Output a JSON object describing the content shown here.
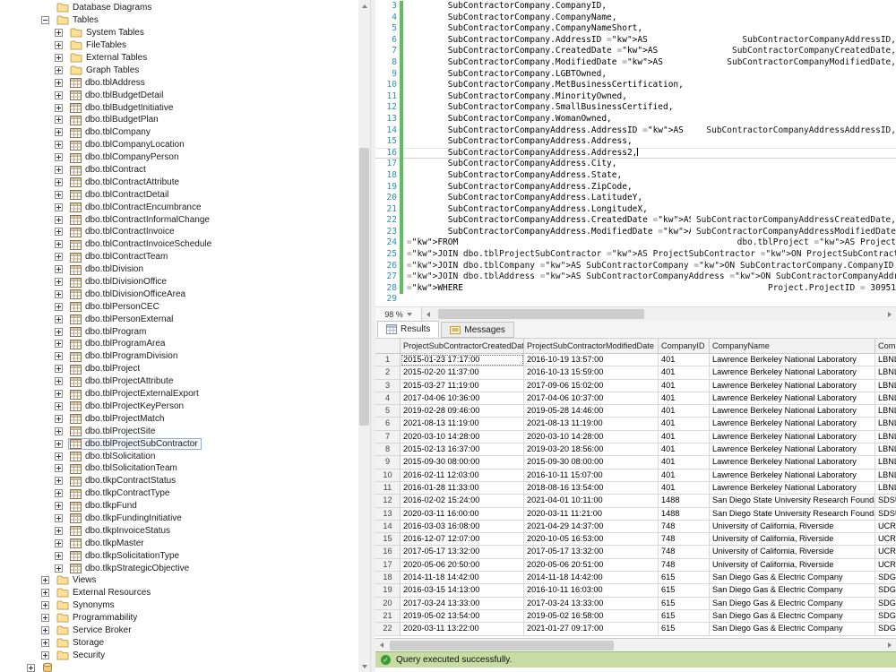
{
  "object_explorer": {
    "items": [
      {
        "label": "Database Diagrams",
        "indent": 1,
        "expander": "none",
        "icon": "folder"
      },
      {
        "label": "Tables",
        "indent": 1,
        "expander": "minus",
        "icon": "folder"
      },
      {
        "label": "System Tables",
        "indent": 2,
        "expander": "plus",
        "icon": "folder"
      },
      {
        "label": "FileTables",
        "indent": 2,
        "expander": "plus",
        "icon": "folder"
      },
      {
        "label": "External Tables",
        "indent": 2,
        "expander": "plus",
        "icon": "folder"
      },
      {
        "label": "Graph Tables",
        "indent": 2,
        "expander": "plus",
        "icon": "folder"
      },
      {
        "label": "dbo.tblAddress",
        "indent": 2,
        "expander": "plus",
        "icon": "table"
      },
      {
        "label": "dbo.tblBudgetDetail",
        "indent": 2,
        "expander": "plus",
        "icon": "table"
      },
      {
        "label": "dbo.tblBudgetInitiative",
        "indent": 2,
        "expander": "plus",
        "icon": "table"
      },
      {
        "label": "dbo.tblBudgetPlan",
        "indent": 2,
        "expander": "plus",
        "icon": "table"
      },
      {
        "label": "dbo.tblCompany",
        "indent": 2,
        "expander": "plus",
        "icon": "table"
      },
      {
        "label": "dbo.tblCompanyLocation",
        "indent": 2,
        "expander": "plus",
        "icon": "table"
      },
      {
        "label": "dbo.tblCompanyPerson",
        "indent": 2,
        "expander": "plus",
        "icon": "table"
      },
      {
        "label": "dbo.tblContract",
        "indent": 2,
        "expander": "plus",
        "icon": "table"
      },
      {
        "label": "dbo.tblContractAttribute",
        "indent": 2,
        "expander": "plus",
        "icon": "table"
      },
      {
        "label": "dbo.tblContractDetail",
        "indent": 2,
        "expander": "plus",
        "icon": "table"
      },
      {
        "label": "dbo.tblContractEncumbrance",
        "indent": 2,
        "expander": "plus",
        "icon": "table"
      },
      {
        "label": "dbo.tblContractInformalChange",
        "indent": 2,
        "expander": "plus",
        "icon": "table"
      },
      {
        "label": "dbo.tblContractInvoice",
        "indent": 2,
        "expander": "plus",
        "icon": "table"
      },
      {
        "label": "dbo.tblContractInvoiceSchedule",
        "indent": 2,
        "expander": "plus",
        "icon": "table"
      },
      {
        "label": "dbo.tblContractTeam",
        "indent": 2,
        "expander": "plus",
        "icon": "table"
      },
      {
        "label": "dbo.tblDivision",
        "indent": 2,
        "expander": "plus",
        "icon": "table"
      },
      {
        "label": "dbo.tblDivisionOffice",
        "indent": 2,
        "expander": "plus",
        "icon": "table"
      },
      {
        "label": "dbo.tblDivisionOfficeArea",
        "indent": 2,
        "expander": "plus",
        "icon": "table"
      },
      {
        "label": "dbo.tblPersonCEC",
        "indent": 2,
        "expander": "plus",
        "icon": "table"
      },
      {
        "label": "dbo.tblPersonExternal",
        "indent": 2,
        "expander": "plus",
        "icon": "table"
      },
      {
        "label": "dbo.tblProgram",
        "indent": 2,
        "expander": "plus",
        "icon": "table"
      },
      {
        "label": "dbo.tblProgramArea",
        "indent": 2,
        "expander": "plus",
        "icon": "table"
      },
      {
        "label": "dbo.tblProgramDivision",
        "indent": 2,
        "expander": "plus",
        "icon": "table"
      },
      {
        "label": "dbo.tblProject",
        "indent": 2,
        "expander": "plus",
        "icon": "table"
      },
      {
        "label": "dbo.tblProjectAttribute",
        "indent": 2,
        "expander": "plus",
        "icon": "table"
      },
      {
        "label": "dbo.tblProjectExternalExport",
        "indent": 2,
        "expander": "plus",
        "icon": "table"
      },
      {
        "label": "dbo.tblProjectKeyPerson",
        "indent": 2,
        "expander": "plus",
        "icon": "table"
      },
      {
        "label": "dbo.tblProjectMatch",
        "indent": 2,
        "expander": "plus",
        "icon": "table"
      },
      {
        "label": "dbo.tblProjectSite",
        "indent": 2,
        "expander": "plus",
        "icon": "table"
      },
      {
        "label": "dbo.tblProjectSubContractor",
        "indent": 2,
        "expander": "plus",
        "icon": "table",
        "selected": true
      },
      {
        "label": "dbo.tblSolicitation",
        "indent": 2,
        "expander": "plus",
        "icon": "table"
      },
      {
        "label": "dbo.tblSolicitationTeam",
        "indent": 2,
        "expander": "plus",
        "icon": "table"
      },
      {
        "label": "dbo.tlkpContractStatus",
        "indent": 2,
        "expander": "plus",
        "icon": "table"
      },
      {
        "label": "dbo.tlkpContractType",
        "indent": 2,
        "expander": "plus",
        "icon": "table"
      },
      {
        "label": "dbo.tlkpFund",
        "indent": 2,
        "expander": "plus",
        "icon": "table"
      },
      {
        "label": "dbo.tlkpFundingInitiative",
        "indent": 2,
        "expander": "plus",
        "icon": "table"
      },
      {
        "label": "dbo.tlkpInvoiceStatus",
        "indent": 2,
        "expander": "plus",
        "icon": "table"
      },
      {
        "label": "dbo.tlkpMaster",
        "indent": 2,
        "expander": "plus",
        "icon": "table"
      },
      {
        "label": "dbo.tlkpSolicitationType",
        "indent": 2,
        "expander": "plus",
        "icon": "table"
      },
      {
        "label": "dbo.tlkpStrategicObjective",
        "indent": 2,
        "expander": "plus",
        "icon": "table"
      },
      {
        "label": "Views",
        "indent": 1,
        "expander": "plus",
        "icon": "folder"
      },
      {
        "label": "External Resources",
        "indent": 1,
        "expander": "plus",
        "icon": "folder"
      },
      {
        "label": "Synonyms",
        "indent": 1,
        "expander": "plus",
        "icon": "folder"
      },
      {
        "label": "Programmability",
        "indent": 1,
        "expander": "plus",
        "icon": "folder"
      },
      {
        "label": "Service Broker",
        "indent": 1,
        "expander": "plus",
        "icon": "folder"
      },
      {
        "label": "Storage",
        "indent": 1,
        "expander": "plus",
        "icon": "folder"
      },
      {
        "label": "Security",
        "indent": 1,
        "expander": "plus",
        "icon": "folder"
      },
      {
        "label": "",
        "indent": 0,
        "expander": "plus",
        "icon": "database"
      }
    ]
  },
  "editor": {
    "zoom_label": "98 %",
    "cursor_line": 16,
    "lines": [
      {
        "num": 3,
        "changed": true,
        "text": "        SubContractorCompany.CompanyID,"
      },
      {
        "num": 4,
        "changed": true,
        "text": "        SubContractorCompany.CompanyName,"
      },
      {
        "num": 5,
        "changed": true,
        "text": "        SubContractorCompany.CompanyNameShort,"
      },
      {
        "num": 6,
        "changed": true,
        "text": "        SubContractorCompany.AddressID AS SubContractorCompanyAddressID,"
      },
      {
        "num": 7,
        "changed": true,
        "text": "        SubContractorCompany.CreatedDate AS SubContractorCompanyCreatedDate,"
      },
      {
        "num": 8,
        "changed": true,
        "text": "        SubContractorCompany.ModifiedDate AS SubContractorCompanyModifiedDate,"
      },
      {
        "num": 9,
        "changed": true,
        "text": "        SubContractorCompany.LGBTOwned,"
      },
      {
        "num": 10,
        "changed": true,
        "text": "        SubContractorCompany.MetBusinessCertification,"
      },
      {
        "num": 11,
        "changed": true,
        "text": "        SubContractorCompany.MinorityOwned,"
      },
      {
        "num": 12,
        "changed": true,
        "text": "        SubContractorCompany.SmallBusinessCertified,"
      },
      {
        "num": 13,
        "changed": true,
        "text": "        SubContractorCompany.WomanOwned,"
      },
      {
        "num": 14,
        "changed": true,
        "text": "        SubContractorCompanyAddress.AddressID AS SubContractorCompanyAddressAddressID,"
      },
      {
        "num": 15,
        "changed": true,
        "text": "        SubContractorCompanyAddress.Address,"
      },
      {
        "num": 16,
        "changed": true,
        "text": "        SubContractorCompanyAddress.Address2,"
      },
      {
        "num": 17,
        "changed": true,
        "text": "        SubContractorCompanyAddress.City,"
      },
      {
        "num": 18,
        "changed": true,
        "text": "        SubContractorCompanyAddress.State,"
      },
      {
        "num": 19,
        "changed": true,
        "text": "        SubContractorCompanyAddress.ZipCode,"
      },
      {
        "num": 20,
        "changed": true,
        "text": "        SubContractorCompanyAddress.LatitudeY,"
      },
      {
        "num": 21,
        "changed": true,
        "text": "        SubContractorCompanyAddress.LongitudeX,"
      },
      {
        "num": 22,
        "changed": true,
        "text": "        SubContractorCompanyAddress.CreatedDate AS SubContractorCompanyAddressCreatedDate,"
      },
      {
        "num": 23,
        "changed": true,
        "text": "        SubContractorCompanyAddress.ModifiedDate AS SubContractorCompanyAddressModifiedDate"
      },
      {
        "num": 24,
        "changed": true,
        "text": "FROM dbo.tblProject AS Project"
      },
      {
        "num": 25,
        "changed": true,
        "text": "INNER JOIN dbo.tblProjectSubContractor AS ProjectSubContractor ON ProjectSubContractor.ProjectNu"
      },
      {
        "num": 26,
        "changed": true,
        "text": "INNER JOIN dbo.tblCompany AS SubContractorCompany ON SubContractorCompany.CompanyID = ProjectSub"
      },
      {
        "num": 27,
        "changed": true,
        "text": "INNER JOIN dbo.tblAddress AS SubContractorCompanyAddress ON SubContractorCompanyAddress.AddressI"
      },
      {
        "num": 28,
        "changed": true,
        "text": "WHERE Project.ProjectID = 30951"
      },
      {
        "num": 29,
        "changed": false,
        "text": ""
      }
    ]
  },
  "results_pane": {
    "tabs": [
      {
        "label": "Results",
        "icon": "grid",
        "active": true
      },
      {
        "label": "Messages",
        "icon": "messages",
        "active": false
      }
    ],
    "grid": {
      "columns": [
        "ProjectSubContractorCreatedDate",
        "ProjectSubContractorModifiedDate",
        "CompanyID",
        "CompanyName",
        "Compa"
      ],
      "selected_cell": {
        "row": 1,
        "col": 1
      },
      "rows": [
        [
          "2015-01-23 17:17:00",
          "2016-10-19 13:57:00",
          "401",
          "Lawrence Berkeley National Laboratory",
          "LBNL"
        ],
        [
          "2015-02-20 11:37:00",
          "2016-10-13 15:59:00",
          "401",
          "Lawrence Berkeley National Laboratory",
          "LBNL"
        ],
        [
          "2015-03-27 11:19:00",
          "2017-09-06 15:02:00",
          "401",
          "Lawrence Berkeley National Laboratory",
          "LBNL"
        ],
        [
          "2017-04-06 10:36:00",
          "2017-04-06 10:37:00",
          "401",
          "Lawrence Berkeley National Laboratory",
          "LBNL"
        ],
        [
          "2019-02-28 09:46:00",
          "2019-05-28 14:46:00",
          "401",
          "Lawrence Berkeley National Laboratory",
          "LBNL"
        ],
        [
          "2021-08-13 11:19:00",
          "2021-08-13 11:19:00",
          "401",
          "Lawrence Berkeley National Laboratory",
          "LBNL"
        ],
        [
          "2020-03-10 14:28:00",
          "2020-03-10 14:28:00",
          "401",
          "Lawrence Berkeley National Laboratory",
          "LBNL"
        ],
        [
          "2015-02-13 16:37:00",
          "2019-03-20 18:56:00",
          "401",
          "Lawrence Berkeley National Laboratory",
          "LBNL"
        ],
        [
          "2015-09-30 08:00:00",
          "2015-09-30 08:00:00",
          "401",
          "Lawrence Berkeley National Laboratory",
          "LBNL"
        ],
        [
          "2016-02-11 12:03:00",
          "2016-10-11 15:07:00",
          "401",
          "Lawrence Berkeley National Laboratory",
          "LBNL"
        ],
        [
          "2016-01-28 11:33:00",
          "2018-08-16 13:54:00",
          "401",
          "Lawrence Berkeley National Laboratory",
          "LBNL"
        ],
        [
          "2016-02-02 15:24:00",
          "2021-04-01 10:11:00",
          "1488",
          "San Diego State University Research Foundation",
          "SDSU"
        ],
        [
          "2020-03-11 16:00:00",
          "2020-03-11 11:21:00",
          "1488",
          "San Diego State University Research Foundation",
          "SDSU"
        ],
        [
          "2016-03-03 16:08:00",
          "2021-04-29 14:37:00",
          "748",
          "University of California, Riverside",
          "UCR"
        ],
        [
          "2016-12-07 12:07:00",
          "2020-10-05 16:53:00",
          "748",
          "University of California, Riverside",
          "UCR"
        ],
        [
          "2017-05-17 13:32:00",
          "2017-05-17 13:32:00",
          "748",
          "University of California, Riverside",
          "UCR"
        ],
        [
          "2020-05-06 20:50:00",
          "2020-05-06 20:51:00",
          "748",
          "University of California, Riverside",
          "UCR"
        ],
        [
          "2014-11-18 14:42:00",
          "2014-11-18 14:42:00",
          "615",
          "San Diego Gas & Electric Company",
          "SDG&"
        ],
        [
          "2016-03-15 14:13:00",
          "2016-10-11 16:03:00",
          "615",
          "San Diego Gas & Electric Company",
          "SDG&"
        ],
        [
          "2017-03-24 13:33:00",
          "2017-03-24 13:33:00",
          "615",
          "San Diego Gas & Electric Company",
          "SDG&"
        ],
        [
          "2019-05-02 13:54:00",
          "2019-05-02 16:58:00",
          "615",
          "San Diego Gas & Electric Company",
          "SDG&"
        ],
        [
          "2020-03-11 13:22:00",
          "2021-01-27 09:17:00",
          "615",
          "San Diego Gas & Electric Company",
          "SDG&"
        ]
      ]
    }
  },
  "status_bar": {
    "text": "Query executed successfully.",
    "background": "#c6dca2",
    "check_color": "#3c9b35"
  }
}
